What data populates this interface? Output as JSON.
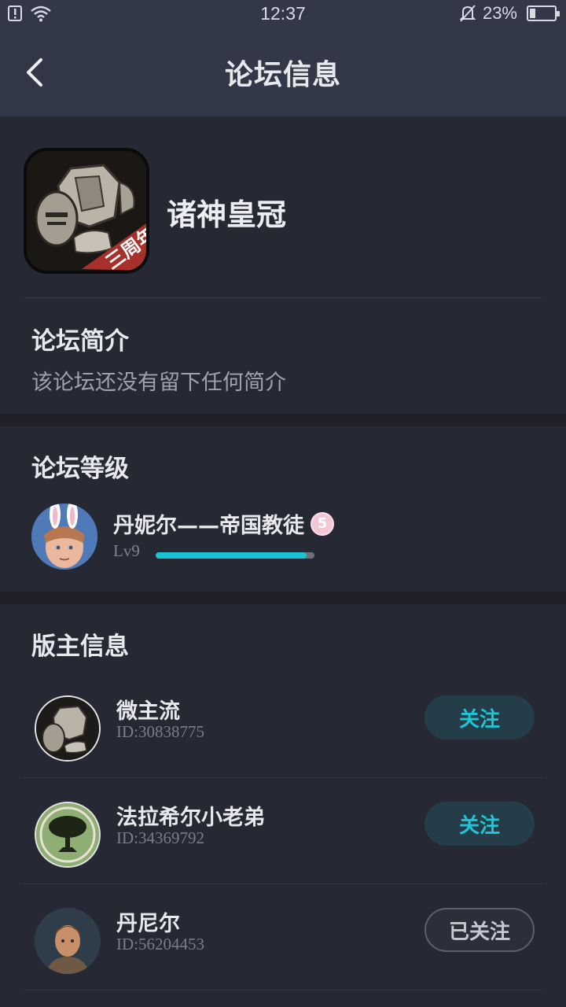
{
  "status_bar": {
    "time": "12:37",
    "battery": "23%",
    "battery_level": 0.23
  },
  "header": {
    "title": "论坛信息"
  },
  "forum": {
    "name": "诸神皇冠",
    "icon_banner": "三周年",
    "intro_title": "论坛简介",
    "intro_text": "该论坛还没有留下任何简介"
  },
  "level": {
    "title": "论坛等级",
    "user_name": "丹妮尔——帝国教徒",
    "badge": "5",
    "level_label": "Lv9",
    "progress": 0.95,
    "accent": "#19c3d3"
  },
  "moderators": {
    "title": "版主信息",
    "items": [
      {
        "name": "微主流",
        "id": "ID:30838775",
        "button": "关注",
        "followed": false
      },
      {
        "name": "法拉希尔小老弟",
        "id": "ID:34369792",
        "button": "关注",
        "followed": false
      },
      {
        "name": "丹尼尔",
        "id": "ID:56204453",
        "button": "已关注",
        "followed": true
      }
    ]
  }
}
